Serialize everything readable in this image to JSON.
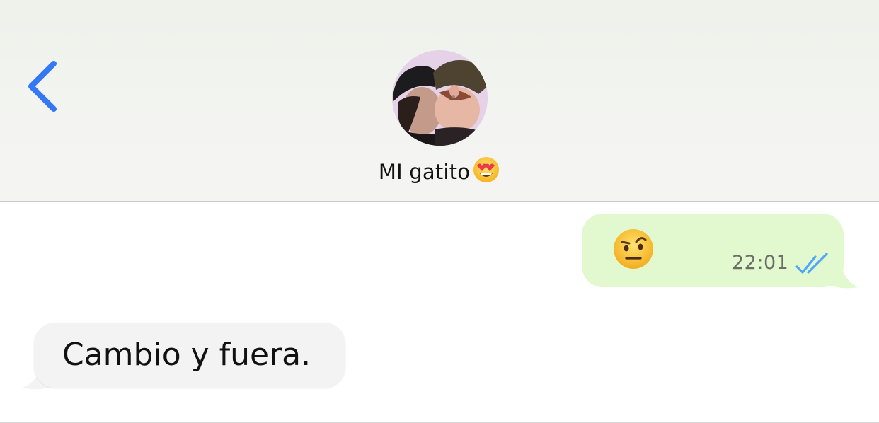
{
  "header": {
    "back_icon": "chevron-left-icon",
    "contact_name": "MI gatito",
    "contact_emoji": "heart-eyes-emoji",
    "avatar": "contact-avatar-photo"
  },
  "messages": [
    {
      "direction": "outgoing",
      "content_emoji": "raised-eyebrow-emoji",
      "time": "22:01",
      "status": "read-double-check-icon"
    },
    {
      "direction": "incoming",
      "text": "Cambio y fuera."
    }
  ],
  "colors": {
    "accent": "#3478f6",
    "outgoing_bubble": "#e2f8cf",
    "incoming_bubble": "#f3f3f4",
    "read_ticks": "#4fa8f5"
  }
}
